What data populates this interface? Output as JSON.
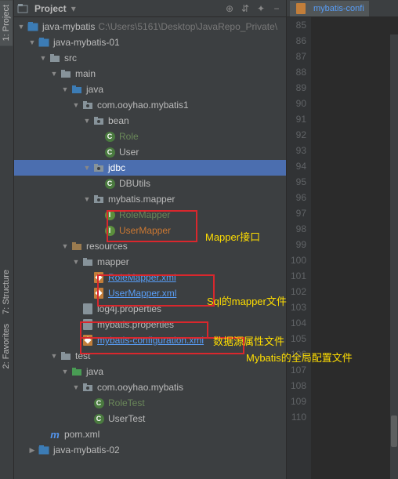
{
  "panel": {
    "title": "Project"
  },
  "editor_tab": {
    "label": "mybatis-confi",
    "close": "×"
  },
  "tree": [
    {
      "indent": 0,
      "arrow": "▼",
      "icon": "module",
      "label": "java-mybatis",
      "path": "C:\\Users\\5161\\Desktop\\JavaRepo_Private\\"
    },
    {
      "indent": 1,
      "arrow": "▼",
      "icon": "module",
      "label": "java-mybatis-01"
    },
    {
      "indent": 2,
      "arrow": "▼",
      "icon": "folder",
      "label": "src"
    },
    {
      "indent": 3,
      "arrow": "▼",
      "icon": "folder",
      "label": "main"
    },
    {
      "indent": 4,
      "arrow": "▼",
      "icon": "src-folder",
      "label": "java"
    },
    {
      "indent": 5,
      "arrow": "▼",
      "icon": "package",
      "label": "com.ooyhao.mybatis1"
    },
    {
      "indent": 6,
      "arrow": "▼",
      "icon": "package",
      "label": "bean"
    },
    {
      "indent": 7,
      "arrow": "",
      "icon": "class-c",
      "label": "Role",
      "cls": "green"
    },
    {
      "indent": 7,
      "arrow": "",
      "icon": "class-c",
      "label": "User"
    },
    {
      "indent": 6,
      "arrow": "▼",
      "icon": "package",
      "label": "jdbc",
      "selected": true
    },
    {
      "indent": 7,
      "arrow": "",
      "icon": "class-c",
      "label": "DBUtils"
    },
    {
      "indent": 6,
      "arrow": "▼",
      "icon": "package",
      "label": "mybatis.mapper"
    },
    {
      "indent": 7,
      "arrow": "",
      "icon": "class-i",
      "label": "RoleMapper",
      "cls": "green"
    },
    {
      "indent": 7,
      "arrow": "",
      "icon": "class-i",
      "label": "UserMapper",
      "cls": "orange"
    },
    {
      "indent": 4,
      "arrow": "▼",
      "icon": "res-folder",
      "label": "resources"
    },
    {
      "indent": 5,
      "arrow": "▼",
      "icon": "folder",
      "label": "mapper"
    },
    {
      "indent": 6,
      "arrow": "",
      "icon": "xml",
      "label": "RoleMapper.xml",
      "cls": "link"
    },
    {
      "indent": 6,
      "arrow": "",
      "icon": "xml",
      "label": "UserMapper.xml",
      "cls": "link"
    },
    {
      "indent": 5,
      "arrow": "",
      "icon": "file",
      "label": "log4j.properties"
    },
    {
      "indent": 5,
      "arrow": "",
      "icon": "file",
      "label": "mybatis.properties"
    },
    {
      "indent": 5,
      "arrow": "",
      "icon": "xml",
      "label": "mybatis-configuration.xml",
      "cls": "link"
    },
    {
      "indent": 3,
      "arrow": "▼",
      "icon": "folder",
      "label": "test"
    },
    {
      "indent": 4,
      "arrow": "▼",
      "icon": "test-folder",
      "label": "java"
    },
    {
      "indent": 5,
      "arrow": "▼",
      "icon": "package",
      "label": "com.ooyhao.mybatis"
    },
    {
      "indent": 6,
      "arrow": "",
      "icon": "class-c",
      "label": "RoleTest",
      "cls": "green"
    },
    {
      "indent": 6,
      "arrow": "",
      "icon": "class-c",
      "label": "UserTest"
    },
    {
      "indent": 2,
      "arrow": "",
      "icon": "maven",
      "label": "pom.xml"
    },
    {
      "indent": 1,
      "arrow": "▶",
      "icon": "module",
      "label": "java-mybatis-02"
    }
  ],
  "line_numbers": [
    "85",
    "86",
    "87",
    "88",
    "89",
    "90",
    "91",
    "92",
    "93",
    "94",
    "95",
    "96",
    "97",
    "98",
    "99",
    "100",
    "101",
    "102",
    "103",
    "104",
    "105",
    "106",
    "107",
    "108",
    "109",
    "110"
  ],
  "annotations": {
    "mapper_if": "Mapper接口",
    "sql_mapper": "Sql的mapper文件",
    "datasource": "数据源属性文件",
    "global_conf": "Mybatis的全局配置文件"
  },
  "sidebar_tabs": {
    "project": "1: Project",
    "structure": "7: Structure",
    "favorites": "2: Favorites"
  }
}
